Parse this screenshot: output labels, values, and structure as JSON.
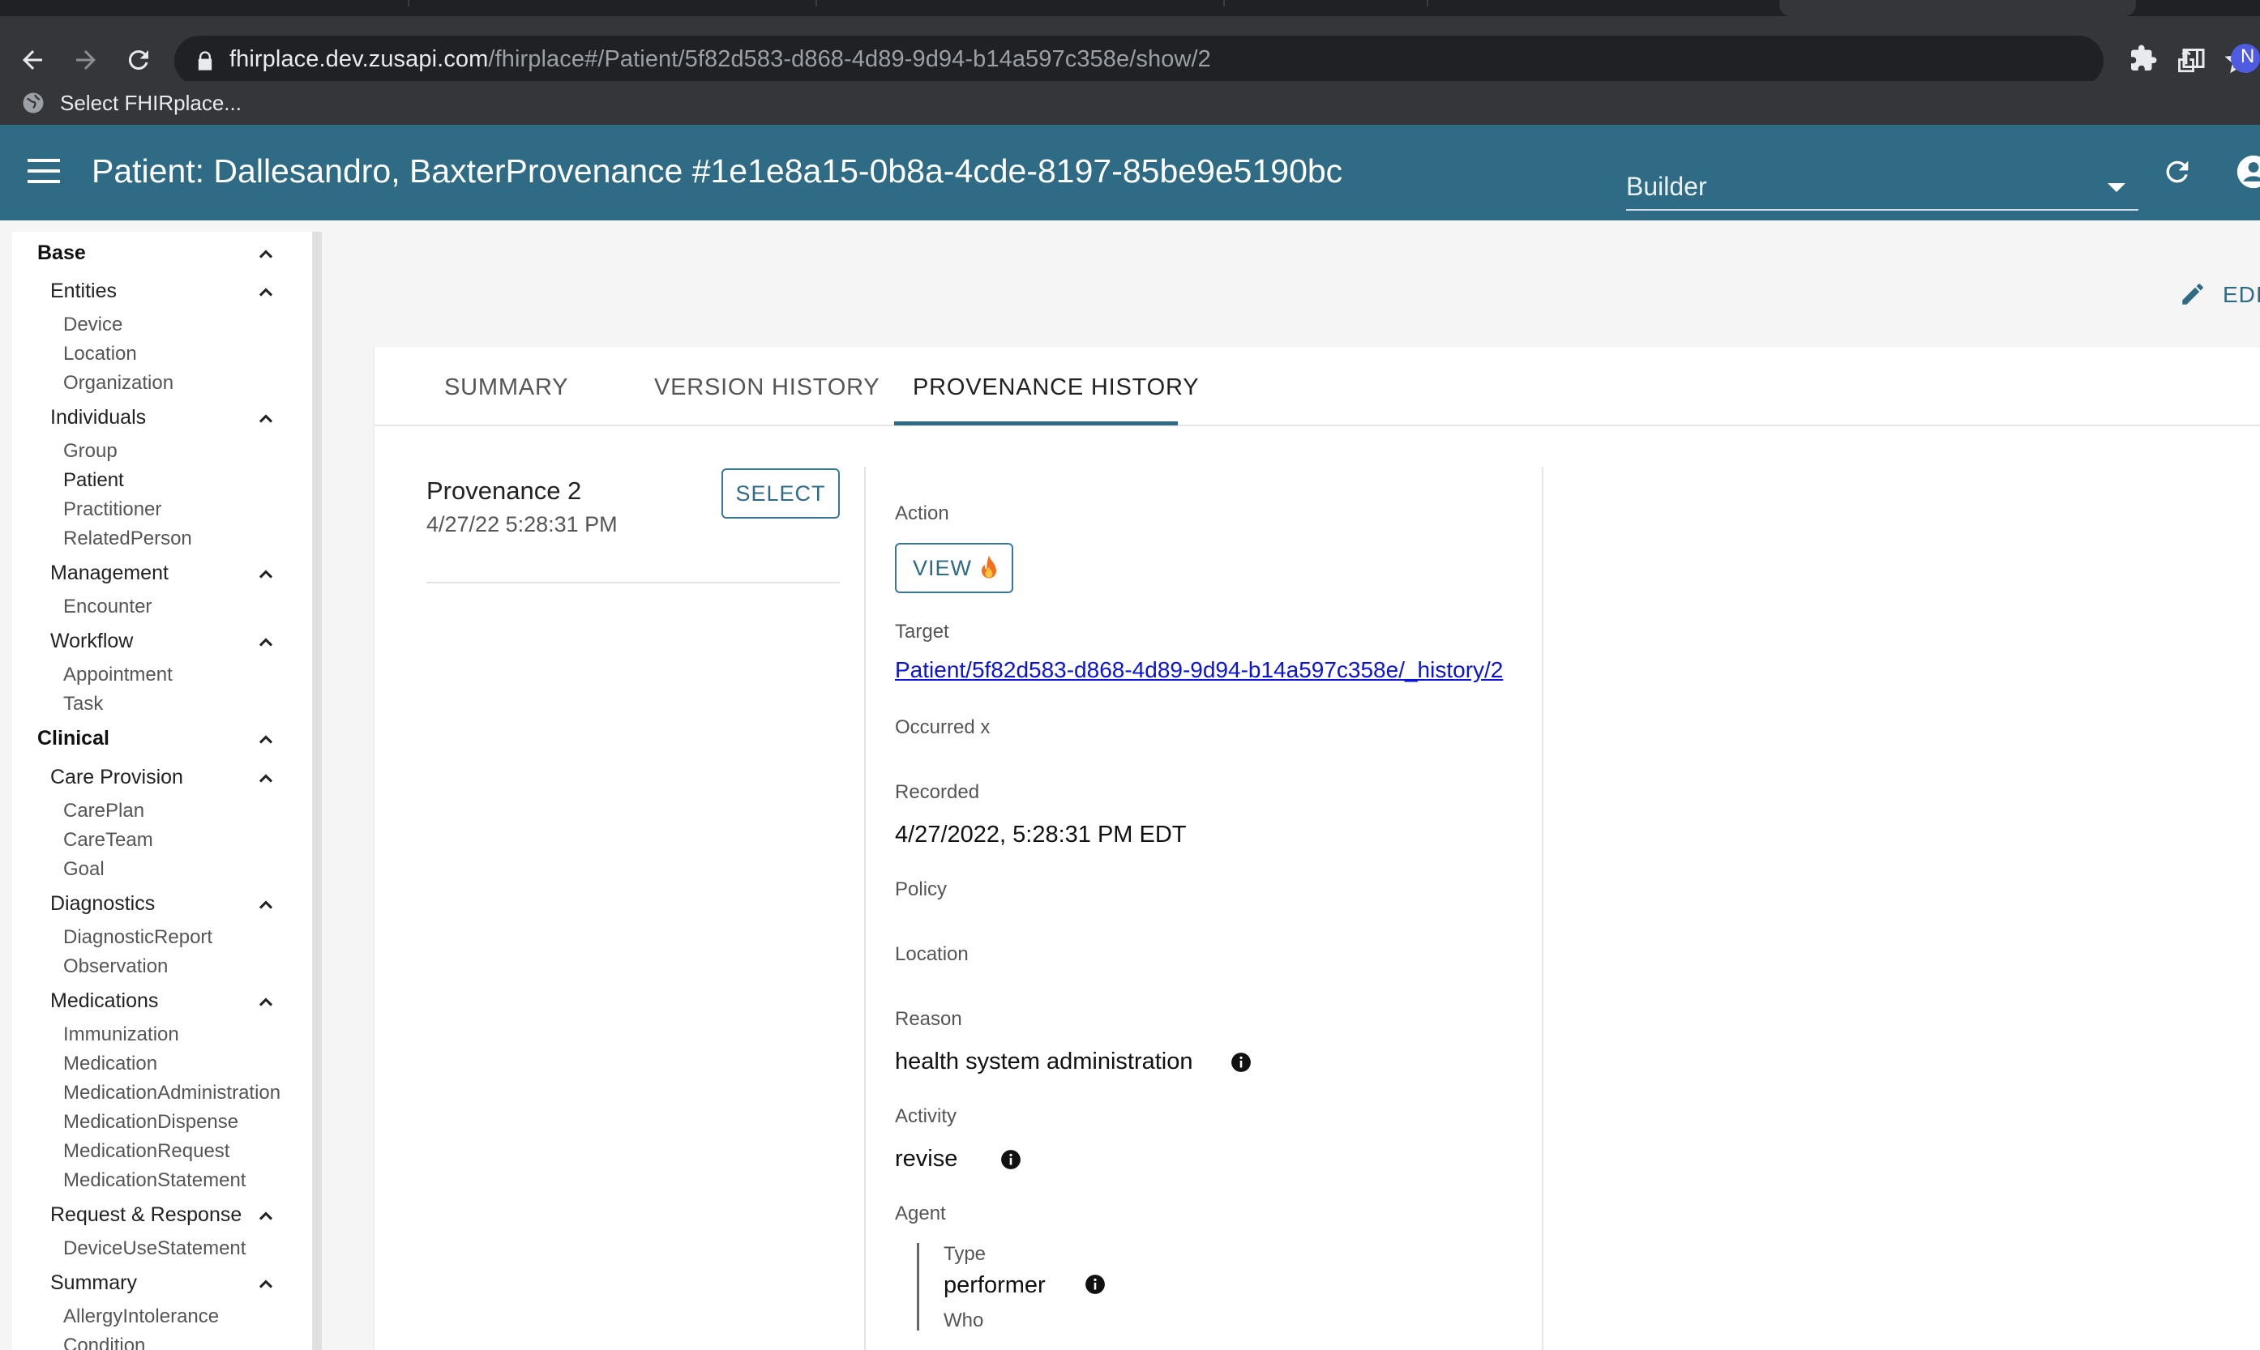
{
  "browser": {
    "url_host": "fhirplace.dev.zusapi.com",
    "url_path": "/fhirplace#/Patient/5f82d583-d868-4d89-9d94-b14a597c358e/show/2",
    "bookmark_label": "Select FHIRplace...",
    "profile_initial": "N"
  },
  "appbar": {
    "title": "Patient: Dallesandro, BaxterProvenance #1e1e8a15-0b8a-4cde-8197-85be9e5190bc",
    "builder_value": "Builder"
  },
  "sidebar": {
    "groups": [
      {
        "label": "Base",
        "subgroups": [
          {
            "label": "Entities",
            "items": [
              "Device",
              "Location",
              "Organization"
            ]
          },
          {
            "label": "Individuals",
            "items": [
              "Group",
              "Patient",
              "Practitioner",
              "RelatedPerson"
            ]
          },
          {
            "label": "Management",
            "items": [
              "Encounter"
            ]
          },
          {
            "label": "Workflow",
            "items": [
              "Appointment",
              "Task"
            ]
          }
        ]
      },
      {
        "label": "Clinical",
        "subgroups": [
          {
            "label": "Care Provision",
            "items": [
              "CarePlan",
              "CareTeam",
              "Goal"
            ]
          },
          {
            "label": "Diagnostics",
            "items": [
              "DiagnosticReport",
              "Observation"
            ]
          },
          {
            "label": "Medications",
            "items": [
              "Immunization",
              "Medication",
              "MedicationAdministration",
              "MedicationDispense",
              "MedicationRequest",
              "MedicationStatement"
            ]
          },
          {
            "label": "Request & Response",
            "items": [
              "DeviceUseStatement"
            ]
          },
          {
            "label": "Summary",
            "items": [
              "AllergyIntolerance",
              "Condition"
            ]
          }
        ]
      }
    ]
  },
  "edit_label": "EDIT",
  "tabs": [
    "SUMMARY",
    "VERSION HISTORY",
    "PROVENANCE HISTORY"
  ],
  "active_tab": "PROVENANCE HISTORY",
  "provenance_list": {
    "title": "Provenance 2",
    "date": "4/27/22 5:28:31 PM",
    "select_label": "SELECT"
  },
  "detail": {
    "action_label": "Action",
    "view_label": "VIEW",
    "target_label": "Target",
    "target_link": "Patient/5f82d583-d868-4d89-9d94-b14a597c358e/_history/2",
    "occurred_label": "Occurred x",
    "recorded_label": "Recorded",
    "recorded_value": "4/27/2022, 5:28:31 PM EDT",
    "policy_label": "Policy",
    "location_label": "Location",
    "reason_label": "Reason",
    "reason_value": "health system administration",
    "activity_label": "Activity",
    "activity_value": "revise",
    "agent_label": "Agent",
    "agent_type_label": "Type",
    "agent_type_value": "performer",
    "agent_who_label": "Who"
  },
  "colors": {
    "appbar": "#2f6b85",
    "accent": "#2f6b85",
    "link": "#0b14d6"
  }
}
